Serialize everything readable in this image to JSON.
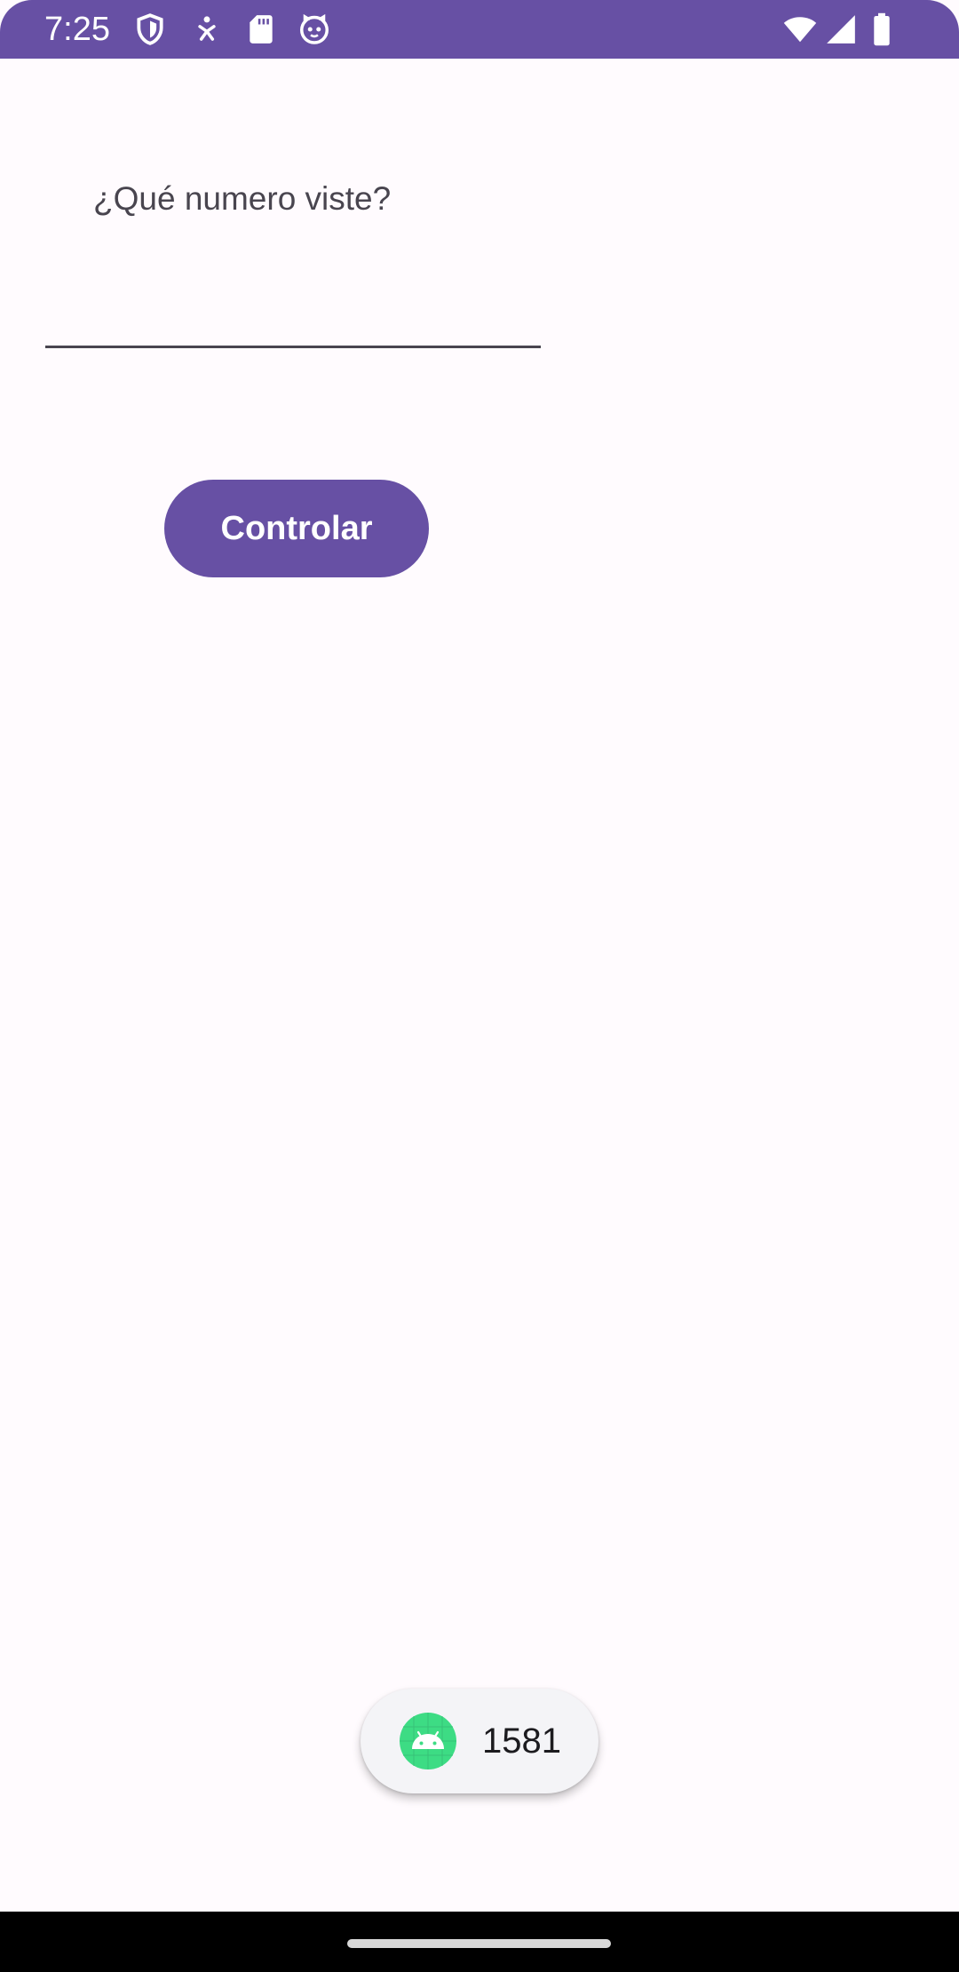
{
  "status_bar": {
    "time": "7:25",
    "background_color": "#6750A4",
    "left_icons": [
      "shield-icon",
      "accessibility-icon",
      "sd-card-icon",
      "cat-face-icon"
    ],
    "right_icons": [
      "wifi-icon",
      "cellular-signal-icon",
      "battery-icon"
    ]
  },
  "main": {
    "prompt": "¿Qué numero viste?",
    "input": {
      "value": "",
      "placeholder": ""
    },
    "button_label": "Controlar",
    "accent_color": "#6750A4"
  },
  "toast": {
    "icon": "android-icon",
    "text": "1581"
  },
  "navigation_bar": {
    "handle": "gesture-handle"
  }
}
